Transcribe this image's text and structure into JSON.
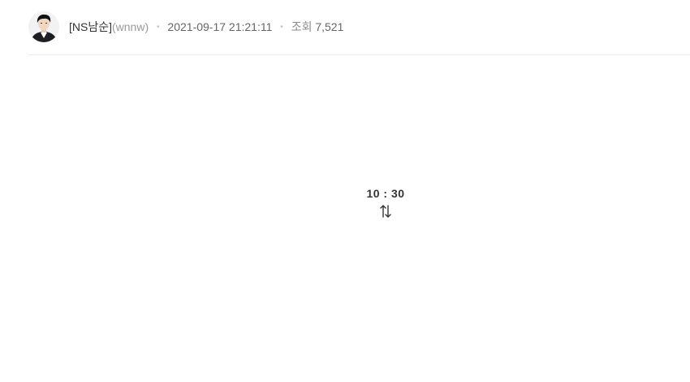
{
  "author": {
    "nickname": "[NS남순]",
    "user_id": "(wnnw)",
    "avatar_icon": "user-avatar"
  },
  "post": {
    "date": "2021-09-17 21:21:11",
    "views_label": "조회",
    "views": "7,521"
  },
  "body": {
    "score_text": "10 : 30",
    "swap_icon": "swap-arrows-icon"
  }
}
